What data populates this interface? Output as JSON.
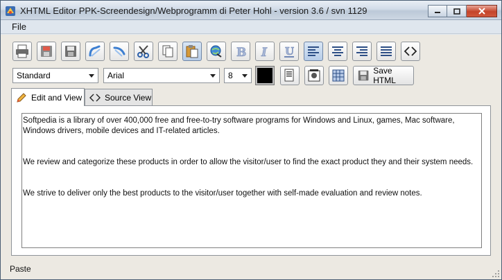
{
  "window": {
    "title": "XHTML Editor PPK-Screendesign/Webprogramm di Peter Hohl - version 3.6 / svn 1129"
  },
  "menu": {
    "items": [
      {
        "label": "File"
      }
    ]
  },
  "toolbar": {
    "buttons": [
      {
        "icon": "print-icon"
      },
      {
        "icon": "open-file-icon"
      },
      {
        "icon": "save-icon"
      },
      {
        "icon": "undo-icon"
      },
      {
        "icon": "redo-icon"
      },
      {
        "icon": "cut-icon"
      },
      {
        "icon": "copy-icon"
      },
      {
        "icon": "paste-icon"
      },
      {
        "icon": "insert-link-icon"
      },
      {
        "icon": "bold-icon"
      },
      {
        "icon": "italic-icon"
      },
      {
        "icon": "underline-icon"
      },
      {
        "icon": "align-left-icon"
      },
      {
        "icon": "align-center-icon"
      },
      {
        "icon": "align-right-icon"
      },
      {
        "icon": "align-justify-icon"
      },
      {
        "icon": "source-code-icon"
      }
    ]
  },
  "format_bar": {
    "style_select": "Standard",
    "font_select": "Arial",
    "size_select": "8",
    "text_color": "#000000",
    "save_html_label": "Save HTML"
  },
  "tabs": [
    {
      "label": "Edit and View",
      "selected": true
    },
    {
      "label": "Source View",
      "selected": false
    }
  ],
  "editor": {
    "paragraphs": [
      "Softpedia is a library of over 400,000 free and free-to-try software programs for Windows and Linux, games, Mac software, Windows drivers, mobile devices and IT-related articles.",
      "",
      "We review and categorize these products in order to allow the visitor/user to find the exact product they and their system needs.",
      "",
      "We strive to deliver only the best products to the visitor/user together with self-made evaluation and review notes."
    ]
  },
  "status": {
    "text": "Paste"
  }
}
